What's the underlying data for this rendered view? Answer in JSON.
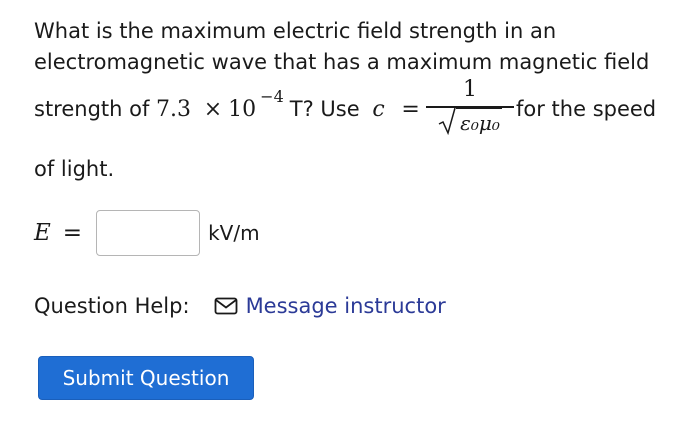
{
  "question": {
    "line1": "What is the maximum electric field strength in an",
    "line2": "electromagnetic wave that has a maximum magnetic field",
    "line3_prefix": "strength of ",
    "coefficient": "7.3",
    "times": "×",
    "base": "10",
    "exponent": "−4",
    "unit_T": "T? Use",
    "c_var": "c",
    "equals": "=",
    "frac_numerator": "1",
    "frac_denominator": "ε₀μ₀",
    "line3_suffix": "for the speed",
    "line4": "of light."
  },
  "answer": {
    "variable": "E",
    "equals": "=",
    "value": "",
    "unit": "kV/m"
  },
  "help": {
    "label": "Question Help:",
    "icon": "mail-icon",
    "link": "Message instructor",
    "link_color": "#2b3a97"
  },
  "submit": {
    "label": "Submit Question",
    "color": "#1f6ed4"
  }
}
